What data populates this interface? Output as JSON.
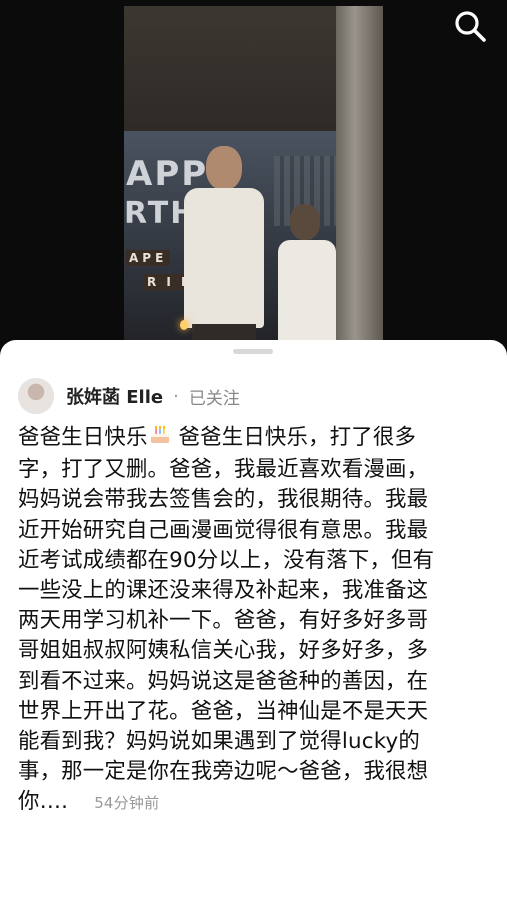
{
  "video": {
    "balloons_row1": "APP",
    "balloons_row2": "RTH",
    "banner_row1": "APE",
    "banner_row2": "R I H"
  },
  "post": {
    "author": "张姩菡 Elle",
    "separator": "·",
    "follow_status": "已关注",
    "lines": [
      "爸爸生日快乐",
      "爸爸生日快乐，打了很多",
      "字，打了又删。爸爸，我最近喜欢看漫画，",
      "妈妈说会带我去签售会的，我很期待。我最",
      "近开始研究自己画漫画觉得很有意思。我最",
      "近考试成绩都在90分以上，没有落下，但有",
      "一些没上的课还没来得及补起来，我准备这",
      "两天用学习机补一下。爸爸，有好多好多哥",
      "哥姐姐叔叔阿姨私信关心我，好多好多，多",
      "到看不过来。妈妈说这是爸爸种的善因，在",
      "世界上开出了花。爸爸，当神仙是不是天天",
      "能看到我？妈妈说如果遇到了觉得lucky的",
      "事，那一定是你在我旁边呢～爸爸，我很想",
      "你…."
    ],
    "timestamp": "54分钟前"
  },
  "icons": {
    "search": "search-icon",
    "cake": "birthday-cake-icon"
  }
}
